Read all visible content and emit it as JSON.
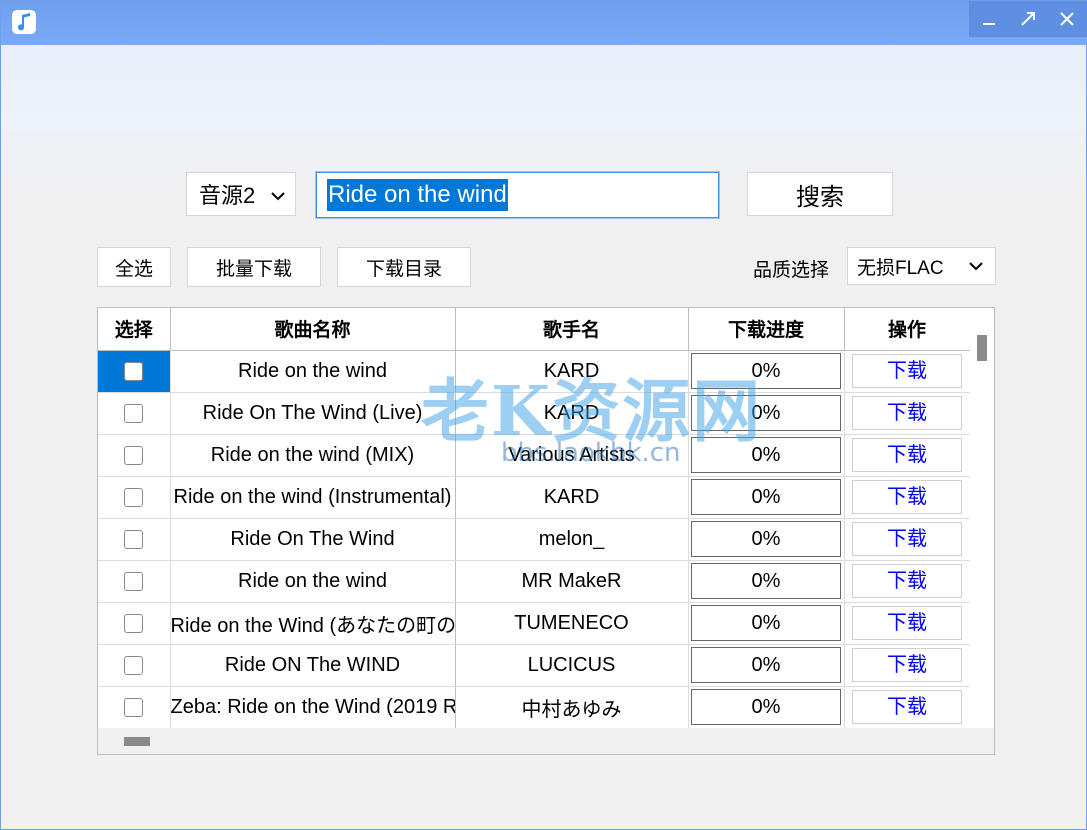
{
  "toolbar": {
    "source_value": "音源2",
    "search_value": "Ride on the wind",
    "search_label": "搜索",
    "select_all_label": "全选",
    "batch_download_label": "批量下载",
    "download_dir_label": "下载目录",
    "quality_label": "品质选择",
    "quality_value": "无损FLAC"
  },
  "table": {
    "headers": [
      "选择",
      "歌曲名称",
      "歌手名",
      "下载进度",
      "操作"
    ],
    "rows": [
      {
        "name": "Ride on the wind",
        "artist": "KARD",
        "progress": "0%",
        "action": "下载"
      },
      {
        "name": "Ride On The Wind (Live)",
        "artist": "KARD",
        "progress": "0%",
        "action": "下载"
      },
      {
        "name": "Ride on the wind (MIX)",
        "artist": "Various Artists",
        "progress": "0%",
        "action": "下载"
      },
      {
        "name": "Ride on the wind (Instrumental)",
        "artist": "KARD",
        "progress": "0%",
        "action": "下载"
      },
      {
        "name": "Ride On The Wind",
        "artist": "melon_",
        "progress": "0%",
        "action": "下载"
      },
      {
        "name": "Ride on the wind",
        "artist": "MR MakeR",
        "progress": "0%",
        "action": "下载"
      },
      {
        "name": "Ride on the Wind (あなたの町の怪",
        "artist": "TUMENECO",
        "progress": "0%",
        "action": "下载"
      },
      {
        "name": "Ride ON The WIND",
        "artist": "LUCICUS",
        "progress": "0%",
        "action": "下载"
      },
      {
        "name": "Zeba: Ride on the Wind (2019 R",
        "artist": "中村あゆみ",
        "progress": "0%",
        "action": "下载"
      }
    ]
  },
  "watermark": {
    "title": "老K资源网",
    "url": "bbs.laokbk.cn"
  },
  "colors": {
    "titlebar": "#6fa0f0",
    "selection": "#0078d7",
    "link": "#0000ff"
  }
}
